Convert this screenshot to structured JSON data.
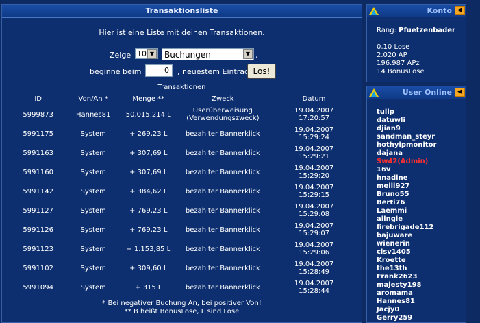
{
  "main": {
    "title": "Transaktionsliste",
    "intro": "Hier ist eine Liste mit deinen Transaktionen.",
    "zeige_label": "Zeige",
    "count_value": "10",
    "type_value": "Buchungen",
    "comma": ",",
    "beginne_label": "beginne beim",
    "start_value": "0",
    "neuestem_label": ", neuestem Eintrag",
    "los_label": "Los!",
    "caption": "Transaktionen",
    "columns": [
      "ID",
      "Von/An *",
      "Menge **",
      "Zweck",
      "Datum"
    ],
    "rows": [
      {
        "id": "5999873",
        "von": "Hannes81",
        "menge": "50.015,214 L",
        "zweck1": "Userüberweisung",
        "zweck2": "(Verwendungszweck)",
        "date": "19.04.2007",
        "time": "17:20:57"
      },
      {
        "id": "5991175",
        "von": "System",
        "menge": "+ 269,23 L",
        "zweck1": "bezahlter Bannerklick",
        "zweck2": "",
        "date": "19.04.2007",
        "time": "15:29:24"
      },
      {
        "id": "5991163",
        "von": "System",
        "menge": "+ 307,69 L",
        "zweck1": "bezahlter Bannerklick",
        "zweck2": "",
        "date": "19.04.2007",
        "time": "15:29:21"
      },
      {
        "id": "5991160",
        "von": "System",
        "menge": "+ 307,69 L",
        "zweck1": "bezahlter Bannerklick",
        "zweck2": "",
        "date": "19.04.2007",
        "time": "15:29:20"
      },
      {
        "id": "5991142",
        "von": "System",
        "menge": "+ 384,62 L",
        "zweck1": "bezahlter Bannerklick",
        "zweck2": "",
        "date": "19.04.2007",
        "time": "15:29:15"
      },
      {
        "id": "5991127",
        "von": "System",
        "menge": "+ 769,23 L",
        "zweck1": "bezahlter Bannerklick",
        "zweck2": "",
        "date": "19.04.2007",
        "time": "15:29:08"
      },
      {
        "id": "5991126",
        "von": "System",
        "menge": "+ 769,23 L",
        "zweck1": "bezahlter Bannerklick",
        "zweck2": "",
        "date": "19.04.2007",
        "time": "15:29:07"
      },
      {
        "id": "5991123",
        "von": "System",
        "menge": "+ 1.153,85 L",
        "zweck1": "bezahlter Bannerklick",
        "zweck2": "",
        "date": "19.04.2007",
        "time": "15:29:06"
      },
      {
        "id": "5991102",
        "von": "System",
        "menge": "+ 309,60 L",
        "zweck1": "bezahlter Bannerklick",
        "zweck2": "",
        "date": "19.04.2007",
        "time": "15:28:49"
      },
      {
        "id": "5991094",
        "von": "System",
        "menge": "+ 315 L",
        "zweck1": "bezahlter Bannerklick",
        "zweck2": "",
        "date": "19.04.2007",
        "time": "15:28:44"
      }
    ],
    "foot1": "* Bei negativer Buchung An, bei positiver Von!",
    "foot2": "** B heißt BonusLose, L sind Lose"
  },
  "konto": {
    "title": "Konto",
    "rang_label": "Rang:",
    "rang_value": "Pfuetzenbader",
    "stats": [
      "0,10 Lose",
      "2.020 AP",
      "196.987 APz",
      "14 BonusLose"
    ]
  },
  "online": {
    "title": "User Online",
    "users": [
      "tulip",
      "datuwli",
      "djian9",
      "sandman_steyr",
      "hothyipmonitor",
      "dajana",
      "Sw42(Admin)",
      "16v",
      "hnadine",
      "meili927",
      "Bruno55",
      "Berti76",
      "Laemmi",
      "ailngie",
      "firebrigade112",
      "bajuware",
      "wienerin",
      "clsv1405",
      "Kroette",
      "the13th",
      "Frank2623",
      "majesty198",
      "aromama",
      "Hannes81",
      "Jacjy0",
      "Gerry259"
    ],
    "admin_user": "Sw42(Admin)"
  },
  "colors": {
    "accent": "#0d2f6f",
    "header": "#1a4da6",
    "admin": "#ff3030",
    "button": "#f5a623"
  }
}
